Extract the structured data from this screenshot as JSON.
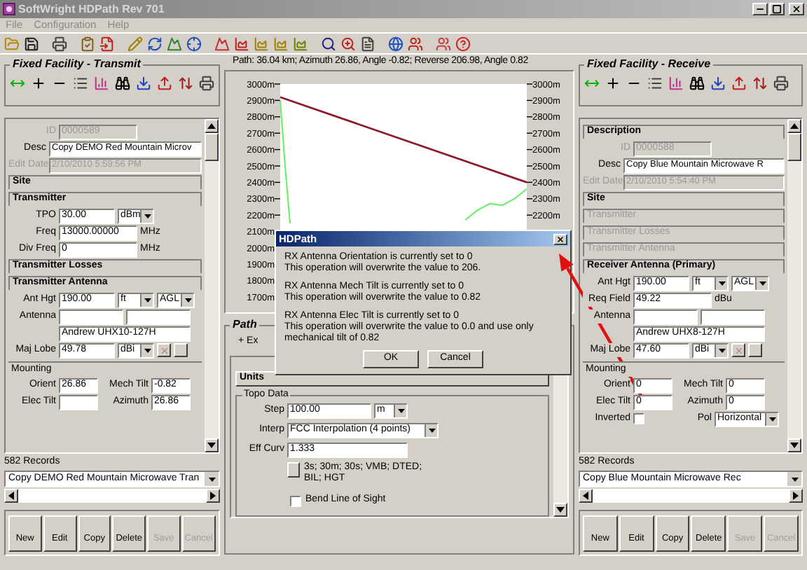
{
  "window": {
    "title": "SoftWright HDPath Rev 701"
  },
  "menu": [
    "File",
    "Configuration",
    "Help"
  ],
  "transmit_panel": {
    "title": "Fixed Facility - Transmit",
    "form": [
      {
        "kind": "field",
        "label": "ID",
        "value": "0000589",
        "disabled": true
      },
      {
        "kind": "wide_field",
        "label": "Desc",
        "value": "Copy DEMO Red Mountain Microv",
        "disabled": false
      },
      {
        "kind": "wide_field",
        "label": "Edit Date",
        "value": "2/10/2010 5:59:56 PM",
        "disabled": true
      },
      {
        "kind": "section",
        "text": "Site",
        "disabled": false
      },
      {
        "kind": "section",
        "text": "Transmitter",
        "disabled": false
      },
      {
        "kind": "field",
        "label": "TPO",
        "value": "30.00",
        "disabled": false,
        "selects": [
          "dBm"
        ]
      },
      {
        "kind": "field",
        "label": "Freq",
        "value": "13000.00000",
        "disabled": false,
        "unit": "MHz"
      },
      {
        "kind": "field",
        "label": "Div Freq",
        "value": "0",
        "disabled": false,
        "unit": "MHz"
      },
      {
        "kind": "section",
        "text": "Transmitter Losses",
        "disabled": false
      },
      {
        "kind": "section",
        "text": "Transmitter Antenna",
        "disabled": false
      },
      {
        "kind": "field",
        "label": "Ant Hgt",
        "value": "190.00",
        "disabled": false,
        "selects": [
          "ft",
          "AGL"
        ]
      },
      {
        "kind": "empty_pair",
        "label": "Antenna"
      },
      {
        "kind": "value_only",
        "value": "Andrew UHX10-127H"
      },
      {
        "kind": "field",
        "label": "Maj Lobe",
        "value": "49.78",
        "disabled": false,
        "selects": [
          "dBi"
        ],
        "tools": true
      },
      {
        "kind": "subtitle",
        "text": "Mounting"
      },
      {
        "kind": "pair",
        "items": [
          {
            "label": "Orient",
            "value": "26.86"
          },
          {
            "label": "Mech Tilt",
            "value": "-0.82"
          }
        ]
      },
      {
        "kind": "pair",
        "items": [
          {
            "label": "Elec Tilt"
          },
          {
            "label": "Azimuth",
            "value": "26.86"
          }
        ]
      }
    ],
    "records": "582 Records",
    "record_select": "Copy DEMO Red Mountain Microwave Tran",
    "buttons": [
      {
        "label": "New",
        "disabled": false
      },
      {
        "label": "Edit",
        "disabled": false
      },
      {
        "label": "Copy",
        "disabled": false
      },
      {
        "label": "Delete",
        "disabled": false
      },
      {
        "label": "Save",
        "disabled": true
      },
      {
        "label": "Cancel",
        "disabled": true
      }
    ]
  },
  "path_summary": "Path: 36.04 km; Azimuth 26.86, Angle -0.82; Reverse 206.98, Angle 0.82",
  "profile": {
    "left_axis": [
      "3000m",
      "2900m",
      "2800m",
      "2700m",
      "2600m",
      "2500m",
      "2400m",
      "2300m",
      "2200m",
      "2100m",
      "2000m",
      "1900m",
      "1800m",
      "1700m"
    ],
    "right_axis": [
      "3000m",
      "2900m",
      "2800m",
      "2700m",
      "2600m",
      "2500m",
      "2400m",
      "2300m",
      "2200m"
    ]
  },
  "path_group": {
    "title": "Path",
    "expand": "+ Ex",
    "units_title": "Units",
    "topo_title": "Topo Data",
    "step": {
      "label": "Step",
      "value": "100.00",
      "unit": "m"
    },
    "interp": {
      "label": "Interp",
      "value": "FCC Interpolation (4 points)"
    },
    "eff_curv": {
      "label": "Eff Curv",
      "value": "1.333"
    },
    "data_types": "3s; 30m; 30s; VMB; DTED; BIL; HGT",
    "bend": {
      "label": "Bend Line of Sight",
      "checked": false
    }
  },
  "receive_panel": {
    "title": "Fixed Facility - Receive",
    "form": [
      {
        "kind": "section",
        "text": "Description",
        "disabled": false
      },
      {
        "kind": "field",
        "label": "ID",
        "value": "0000588",
        "disabled": true
      },
      {
        "kind": "wide_field",
        "label": "Desc",
        "value": "Copy Blue Mountain Microwave R",
        "disabled": false
      },
      {
        "kind": "wide_field",
        "label": "Edit Date",
        "value": "2/10/2010 5:54:40 PM",
        "disabled": true
      },
      {
        "kind": "section",
        "text": "Site",
        "disabled": false
      },
      {
        "kind": "section",
        "text": "Transmitter",
        "disabled": true
      },
      {
        "kind": "section",
        "text": "Transmitter Losses",
        "disabled": true
      },
      {
        "kind": "section",
        "text": "Transmitter Antenna",
        "disabled": true
      },
      {
        "kind": "section",
        "text": "Receiver Antenna (Primary)",
        "disabled": false
      },
      {
        "kind": "field",
        "label": "Ant Hgt",
        "value": "190.00",
        "disabled": false,
        "selects": [
          "ft",
          "AGL"
        ]
      },
      {
        "kind": "field",
        "label": "Req Field",
        "value": "49.22",
        "disabled": false,
        "unit": "dBu"
      },
      {
        "kind": "empty_pair",
        "label": "Antenna"
      },
      {
        "kind": "value_only",
        "value": "Andrew UHX8-127H"
      },
      {
        "kind": "field",
        "label": "Maj Lobe",
        "value": "47.60",
        "disabled": false,
        "selects": [
          "dBi"
        ],
        "tools": true
      },
      {
        "kind": "subtitle",
        "text": "Mounting"
      },
      {
        "kind": "pair",
        "items": [
          {
            "label": "Orient",
            "value": "0"
          },
          {
            "label": "Mech Tilt",
            "value": "0"
          }
        ]
      },
      {
        "kind": "pair",
        "items": [
          {
            "label": "Elec Tilt",
            "value": "0"
          },
          {
            "label": "Azimuth",
            "value": "0"
          }
        ]
      },
      {
        "kind": "check_select",
        "label": "Inverted",
        "checked": false,
        "select_label": "Pol",
        "select_value": "Horizontal"
      }
    ],
    "records": "582 Records",
    "record_select": "Copy Blue Mountain Microwave Rec",
    "buttons": [
      {
        "label": "New",
        "disabled": false
      },
      {
        "label": "Edit",
        "disabled": false
      },
      {
        "label": "Copy",
        "disabled": false
      },
      {
        "label": "Delete",
        "disabled": false
      },
      {
        "label": "Save",
        "disabled": true
      },
      {
        "label": "Cancel",
        "disabled": true
      }
    ]
  },
  "dialog": {
    "title": "HDPath",
    "messages": [
      [
        "RX Antenna Orientation is currently set to 0",
        "This operation will overwrite the value to 206."
      ],
      [
        "RX Antenna Mech Tilt is currently set to 0",
        "This operation will overwrite the value to 0.82"
      ],
      [
        "RX Antenna Elec Tilt is currently set to 0",
        "This operation will overwrite the value to 0.0 and use only mechanical tilt of 0.82"
      ]
    ],
    "buttons": [
      "OK",
      "Cancel"
    ]
  }
}
